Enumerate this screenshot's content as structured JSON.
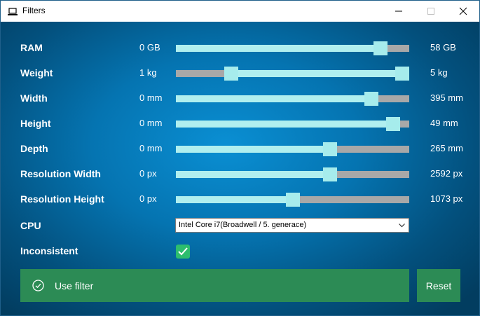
{
  "window": {
    "title": "Filters"
  },
  "sliders": [
    {
      "label": "RAM",
      "min": "0 GB",
      "max": "58 GB",
      "fraction": 0.9
    },
    {
      "label": "Weight",
      "min": "1 kg",
      "max": "5 kg",
      "fraction_low": 0.22,
      "fraction_high": 1.0
    },
    {
      "label": "Width",
      "min": "0 mm",
      "max": "395 mm",
      "fraction": 0.86
    },
    {
      "label": "Height",
      "min": "0 mm",
      "max": "49 mm",
      "fraction": 0.96
    },
    {
      "label": "Depth",
      "min": "0 mm",
      "max": "265 mm",
      "fraction": 0.67
    },
    {
      "label": "Resolution Width",
      "min": "0 px",
      "max": "2592 px",
      "fraction": 0.67
    },
    {
      "label": "Resolution Height",
      "min": "0 px",
      "max": "1073 px",
      "fraction": 0.5
    }
  ],
  "cpu": {
    "label": "CPU",
    "selected": "Intel Core i7(Broadwell / 5. generace)"
  },
  "inconsistent": {
    "label": "Inconsistent",
    "checked": true
  },
  "buttons": {
    "use_filter": "Use filter",
    "reset": "Reset"
  },
  "colors": {
    "button_green": "#2c8b55",
    "slider_fill": "#b0efef",
    "slider_track": "#a8a8a8",
    "checkbox": "#2dbd6e"
  }
}
